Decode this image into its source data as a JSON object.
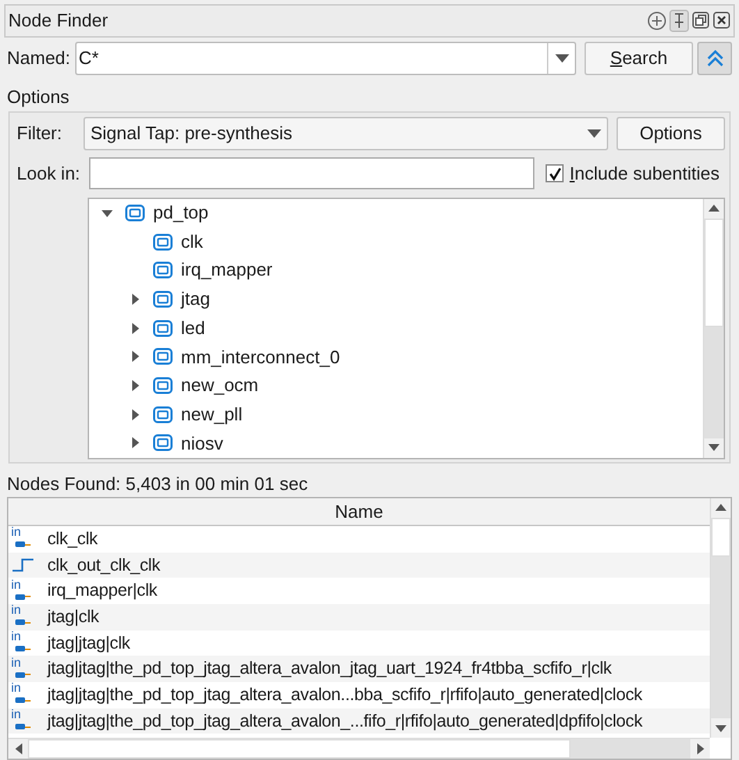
{
  "window": {
    "title": "Node Finder"
  },
  "named": {
    "label": "Named:",
    "value": "C*"
  },
  "search_button": "Search",
  "options_label": "Options",
  "filter": {
    "label": "Filter:",
    "value": "Signal Tap: pre-synthesis"
  },
  "options_button": "Options",
  "look_in": {
    "label": "Look in:"
  },
  "include_subentities": {
    "label": "Include subentities",
    "checked": true
  },
  "tree": [
    {
      "label": "pd_top",
      "expanded": true,
      "children": [
        {
          "label": "clk"
        },
        {
          "label": "irq_mapper"
        },
        {
          "label": "jtag",
          "expanded": false
        },
        {
          "label": "led",
          "expanded": false
        },
        {
          "label": "mm_interconnect_0",
          "expanded": false
        },
        {
          "label": "new_ocm",
          "expanded": false
        },
        {
          "label": "new_pll",
          "expanded": false
        },
        {
          "label": "niosv",
          "expanded": false
        }
      ]
    }
  ],
  "status": "Nodes Found: 5,403 in 00 min 01 sec",
  "table": {
    "columns": [
      "Name"
    ],
    "rows": [
      {
        "kind": "input",
        "icon_text": "in",
        "name": "clk_clk"
      },
      {
        "kind": "clock",
        "name": "clk_out_clk_clk"
      },
      {
        "kind": "input",
        "icon_text": "in",
        "name": "irq_mapper|clk"
      },
      {
        "kind": "input",
        "icon_text": "in",
        "name": "jtag|clk"
      },
      {
        "kind": "input",
        "icon_text": "in",
        "name": "jtag|jtag|clk"
      },
      {
        "kind": "input",
        "icon_text": "in",
        "name": "jtag|jtag|the_pd_top_jtag_altera_avalon_jtag_uart_1924_fr4tbba_scfifo_r|clk"
      },
      {
        "kind": "input",
        "icon_text": "in",
        "name": "jtag|jtag|the_pd_top_jtag_altera_avalon...bba_scfifo_r|rfifo|auto_generated|clock"
      },
      {
        "kind": "input",
        "icon_text": "in",
        "name": "jtag|jtag|the_pd_top_jtag_altera_avalon_...fifo_r|rfifo|auto_generated|dpfifo|clock"
      }
    ]
  }
}
